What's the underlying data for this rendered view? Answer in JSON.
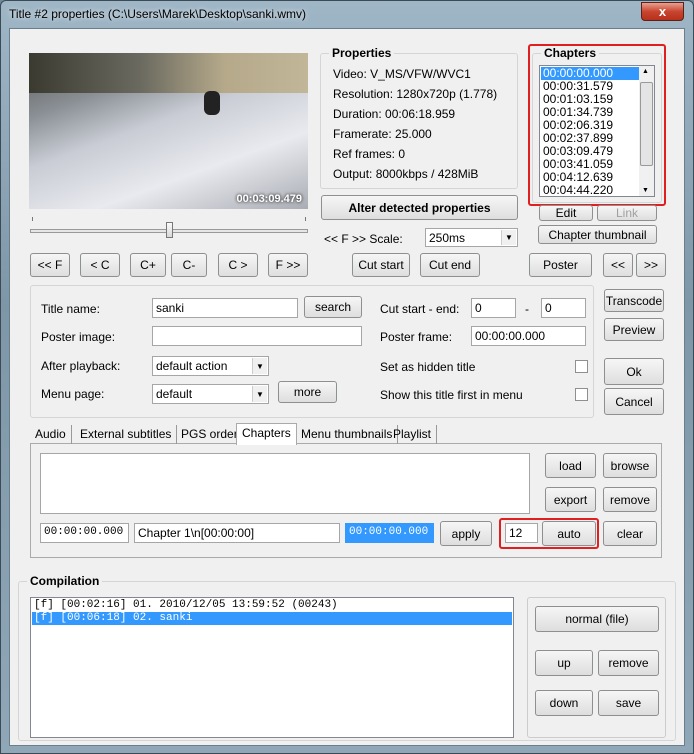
{
  "window": {
    "title": "Title #2 properties (C:\\Users\\Marek\\Desktop\\sanki.wmv)",
    "close": "x"
  },
  "preview": {
    "timestamp": "00:03:09.479",
    "position": 0.5
  },
  "properties": {
    "label": "Properties",
    "lines": [
      "Video: V_MS/VFW/WVC1",
      "Resolution: 1280x720p (1.778)",
      "Duration: 00:06:18.959",
      "Framerate: 25.000",
      "Ref frames: 0",
      "Output: 8000kbps / 428MiB"
    ]
  },
  "chapters": {
    "label": "Chapters",
    "items": [
      "00:00:00.000",
      "00:00:31.579",
      "00:01:03.159",
      "00:01:34.739",
      "00:02:06.319",
      "00:02:37.899",
      "00:03:09.479",
      "00:03:41.059",
      "00:04:12.639",
      "00:04:44.220"
    ],
    "selected": 0,
    "edit": "Edit",
    "link": "Link",
    "thumbnail": "Chapter thumbnail"
  },
  "alter": "Alter detected properties",
  "scale": {
    "label": "<< F >> Scale:",
    "value": "250ms"
  },
  "nav": {
    "ff_back": "<< F",
    "c_back": "< C",
    "c_plus": "C+",
    "c_minus": "C-",
    "c_fwd": "C >",
    "ff_fwd": "F >>",
    "cut_start": "Cut start",
    "cut_end": "Cut end",
    "poster": "Poster",
    "prev": "<<",
    "next": ">>"
  },
  "form": {
    "title_name_label": "Title name:",
    "title_name": "sanki",
    "search": "search",
    "cut_label": "Cut start - end:",
    "cut_start": "0",
    "cut_dash": "-",
    "cut_end": "0",
    "poster_image_label": "Poster image:",
    "poster_image": "",
    "poster_frame_label": "Poster frame:",
    "poster_frame": "00:00:00.000",
    "after_label": "After playback:",
    "after_value": "default action",
    "hidden_label": "Set as hidden title",
    "menu_label": "Menu page:",
    "menu_value": "default",
    "more": "more",
    "first_label": "Show this title first in menu"
  },
  "side": {
    "transcode": "Transcode",
    "preview": "Preview",
    "ok": "Ok",
    "cancel": "Cancel"
  },
  "tabs": [
    {
      "label": "Audio"
    },
    {
      "label": "External subtitles"
    },
    {
      "label": "PGS order"
    },
    {
      "label": "Chapters",
      "active": true
    },
    {
      "label": "Menu thumbnails"
    },
    {
      "label": "Playlist"
    }
  ],
  "chapter_tab": {
    "load": "load",
    "browse": "browse",
    "export": "export",
    "remove": "remove",
    "time": "00:00:00.000",
    "name": "Chapter 1\\n[00:00:00]",
    "time2": "00:00:00.000",
    "apply": "apply",
    "count": "12",
    "auto": "auto",
    "clear": "clear"
  },
  "compilation": {
    "label": "Compilation",
    "items": [
      "[f] [00:02:16] 01. 2010/12/05 13:59:52 (00243)",
      "[f] [00:06:18] 02. sanki"
    ],
    "selected": 1,
    "normal": "normal (file)",
    "up": "up",
    "remove": "remove",
    "down": "down",
    "save": "save"
  },
  "colors": {
    "highlight": "#3399ff",
    "annotation": "#e02020"
  }
}
